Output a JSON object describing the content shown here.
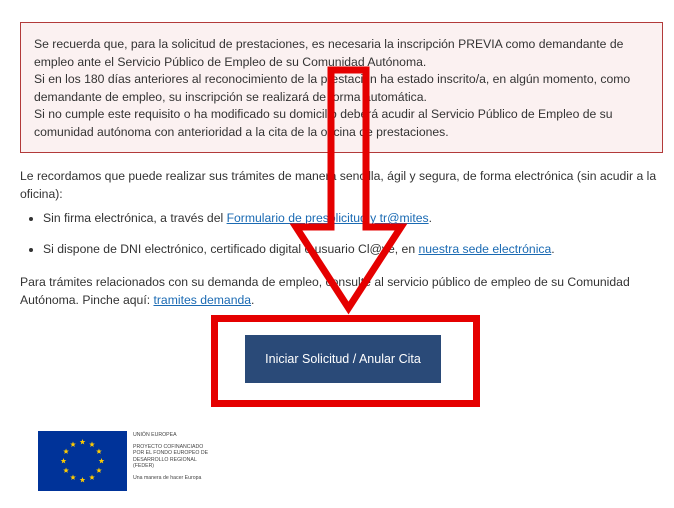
{
  "notice": {
    "line1": "Se recuerda que, para la solicitud de prestaciones, es necesaria la inscripción PREVIA como demandante de empleo ante el Servicio Público de Empleo de su Comunidad Autónoma.",
    "line2": "Si en los 180 días anteriores al reconocimiento de la prestación ha estado inscrito/a, en algún momento, como demandante de empleo, su inscripción se realizará de forma automática.",
    "line3": "Si no cumple este requisito o ha modificado su domicilio deberá acudir al Servicio Público de Empleo de su comunidad autónoma con anterioridad a la cita de la oficina de prestaciones."
  },
  "intro": "Le recordamos que puede realizar sus trámites de manera sencilla, ágil y segura, de forma electrónica (sin acudir a la oficina):",
  "options": [
    {
      "prefix": "Sin firma electrónica, a través del ",
      "link": "Formulario de presolicitud y tr@mites",
      "suffix": "."
    },
    {
      "prefix": "Si dispone de DNI electrónico, certificado digital o usuario Cl@ve, en ",
      "link": "nuestra sede electrónica",
      "suffix": "."
    }
  ],
  "demand": {
    "text": "Para trámites relacionados con su demanda de empleo, consulte al servicio público de empleo de su Comunidad Autónoma. Pinche aquí: ",
    "link": "tramites demanda",
    "suffix": "."
  },
  "main_button": "Iniciar Solicitud / Anular Cita",
  "eu_logo": {
    "line1": "UNIÓN EUROPEA",
    "line2": "PROYECTO COFINANCIADO",
    "line3": "POR EL FONDO EUROPEO DE",
    "line4": "DESARROLLO REGIONAL",
    "line5": "(FEDER)",
    "line6": "Una manera de hacer Europa"
  },
  "colors": {
    "accent_red": "#e50000",
    "button_bg": "#2a4a78",
    "link": "#1a6ab3",
    "eu_blue": "#003399",
    "eu_star": "#ffcc00"
  }
}
